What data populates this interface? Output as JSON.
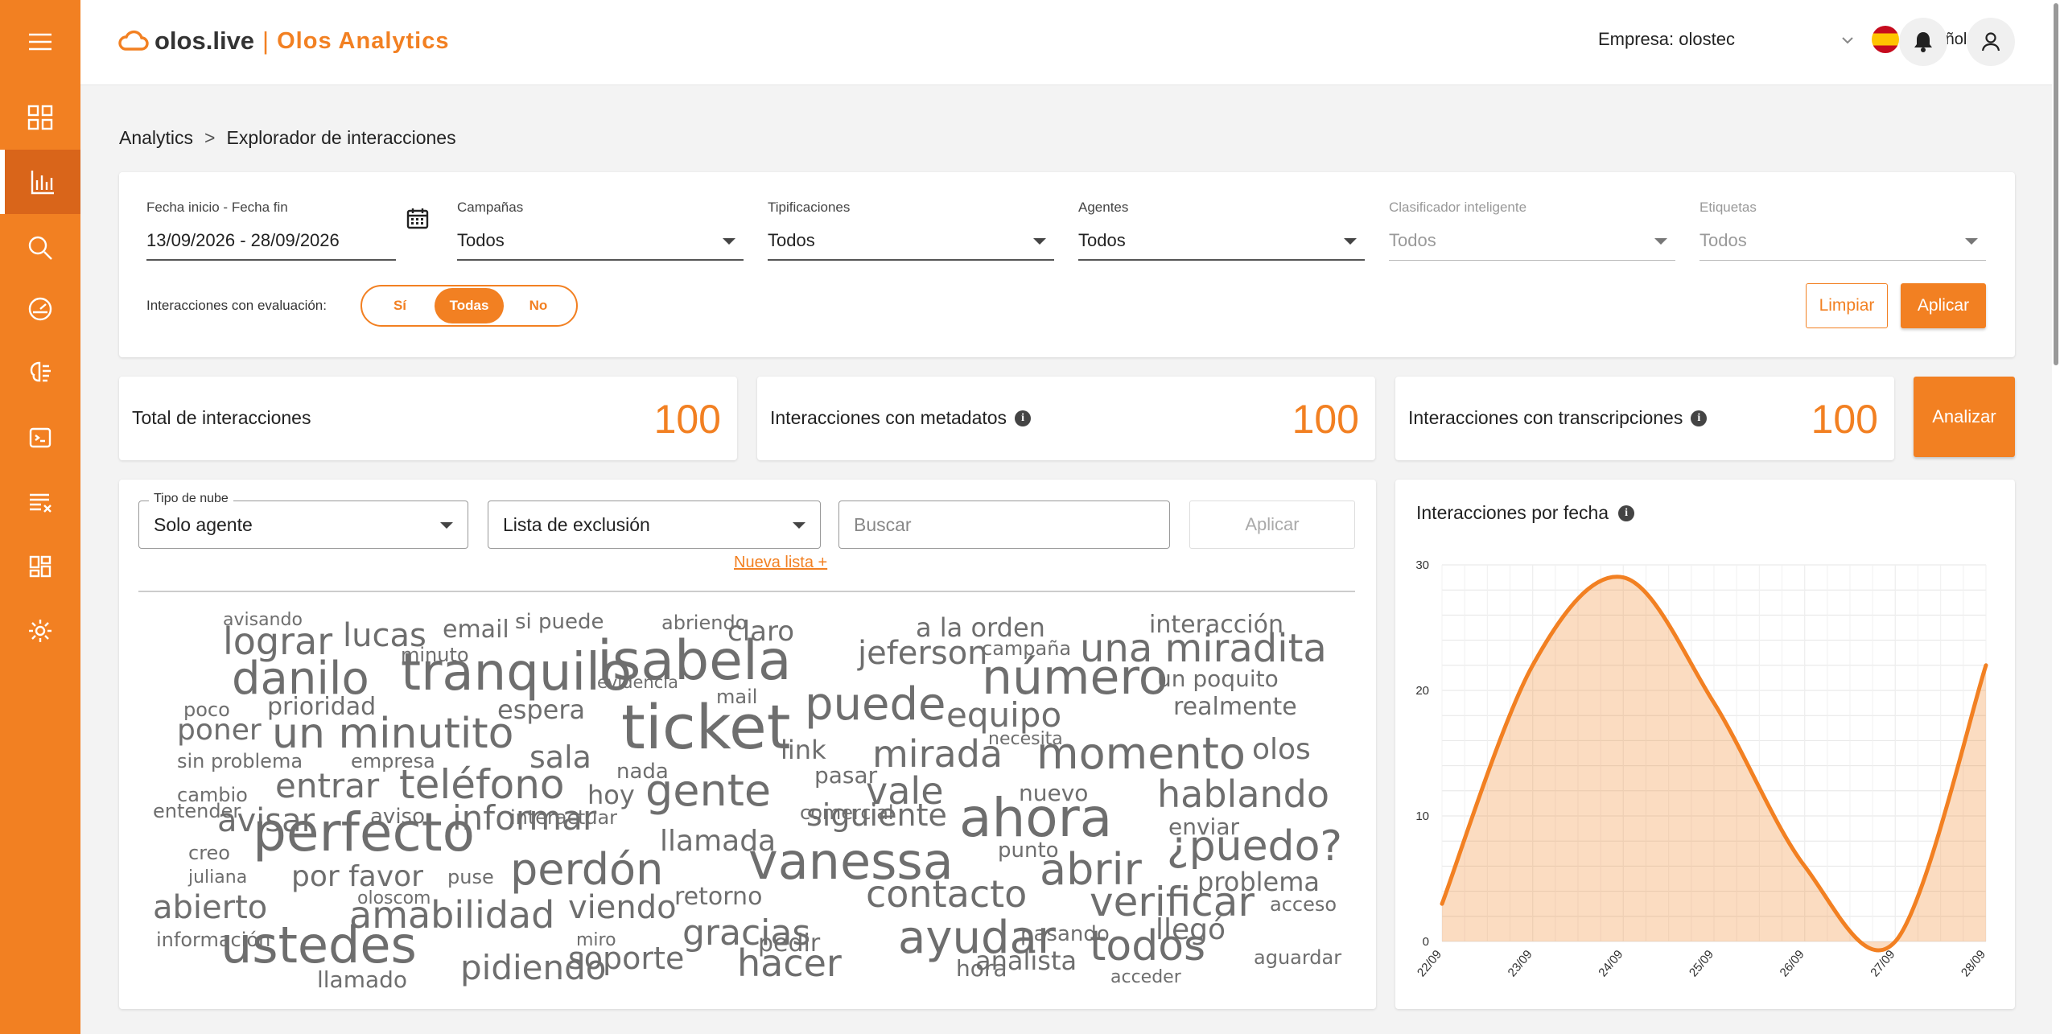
{
  "app": {
    "brand": "olos.live",
    "separator": "|",
    "product": "Olos Analytics"
  },
  "header": {
    "company_label": "Empresa: olostec",
    "language": "Español"
  },
  "sidebar": {
    "items": [
      {
        "icon": "menu-icon"
      },
      {
        "icon": "dashboard-grid-icon"
      },
      {
        "icon": "analytics-bar-chart-icon",
        "active": true
      },
      {
        "icon": "search-icon"
      },
      {
        "icon": "gauge-icon"
      },
      {
        "icon": "brain-icon"
      },
      {
        "icon": "terminal-icon"
      },
      {
        "icon": "list-clear-icon"
      },
      {
        "icon": "layout-icon"
      },
      {
        "icon": "settings-icon"
      }
    ]
  },
  "breadcrumb": {
    "root": "Analytics",
    "separator": ">",
    "current": "Explorador de interacciones"
  },
  "filters": {
    "date": {
      "label": "Fecha inicio - Fecha fin",
      "value": "13/09/2026 - 28/09/2026"
    },
    "campaigns": {
      "label": "Campañas",
      "value": "Todos"
    },
    "tipifications": {
      "label": "Tipificaciones",
      "value": "Todos"
    },
    "agents": {
      "label": "Agentes",
      "value": "Todos"
    },
    "smart_classifier": {
      "label": "Clasificador inteligente",
      "value": "Todos"
    },
    "tags": {
      "label": "Etiquetas",
      "value": "Todos"
    },
    "evaluation_label": "Interacciones con evaluación:",
    "evaluation_options": [
      "Sí",
      "Todas",
      "No"
    ],
    "evaluation_selected": "Todas",
    "clear_label": "Limpiar",
    "apply_label": "Aplicar"
  },
  "stats": {
    "total": {
      "label": "Total de interacciones",
      "value": "100"
    },
    "metadata": {
      "label": "Interacciones con metadatos",
      "value": "100"
    },
    "transcriptions": {
      "label": "Interacciones con transcripciones",
      "value": "100"
    },
    "analyze_label": "Analizar"
  },
  "cloud": {
    "type_legend": "Tipo de nube",
    "type_value": "Solo agente",
    "exclusion_value": "Lista de exclusión",
    "search_placeholder": "Buscar",
    "apply_label": "Aplicar",
    "new_list_label": "Nueva lista +",
    "words": [
      "avisando",
      "lograr",
      "lucas",
      "email",
      "si puede",
      "abriendo",
      "claro",
      "a la orden",
      "interacción",
      "minuto",
      "campaña",
      "jeferson",
      "una miradita",
      "danilo",
      "tranquilo",
      "isabela",
      "número",
      "un poquito",
      "evidencia",
      "mail",
      "poco",
      "prioridad",
      "espera",
      "puede",
      "equipo",
      "realmente",
      "poner",
      "un minutito",
      "ticket",
      "necesita",
      "sin problema",
      "empresa",
      "sala",
      "link",
      "mirada",
      "momento",
      "olos",
      "nada",
      "pasar",
      "cambio",
      "entrar",
      "teléfono",
      "hoy",
      "gente",
      "vale",
      "nuevo",
      "hablando",
      "entender",
      "comercial",
      "interactuar",
      "siguiente",
      "avisar",
      "aviso",
      "informar",
      "ahora",
      "enviar",
      "creo",
      "perfecto",
      "llamada",
      "¿puedo?",
      "punto",
      "juliana",
      "por favor",
      "puse",
      "perdón",
      "vanessa",
      "abrir",
      "problema",
      "oloscom",
      "retorno",
      "contacto",
      "acceso",
      "abierto",
      "viendo",
      "verificar",
      "amabilidad",
      "gracias",
      "pasando",
      "miro",
      "llegó",
      "información",
      "pedir",
      "ayudar",
      "ustedes",
      "soporte",
      "todos",
      "aguardar",
      "pidiendo",
      "hacer",
      "hora",
      "analista",
      "acceder",
      "llamado"
    ]
  },
  "chart": {
    "title": "Interacciones por fecha"
  },
  "chart_data": {
    "type": "area",
    "title": "Interacciones por fecha",
    "xlabel": "",
    "ylabel": "",
    "categories": [
      "22/09",
      "23/09",
      "24/09",
      "25/09",
      "26/09",
      "27/09",
      "28/09"
    ],
    "series": [
      {
        "values": [
          3,
          22,
          29,
          19,
          6,
          0,
          22
        ]
      }
    ],
    "ylim": [
      0,
      30
    ],
    "yticks": [
      0,
      10,
      20,
      30
    ],
    "grid": true,
    "smooth": true,
    "color": "#f28022"
  },
  "colors": {
    "accent": "#f28022",
    "accent_dark": "#d9651a",
    "word_gray": "#6e6e6e"
  }
}
